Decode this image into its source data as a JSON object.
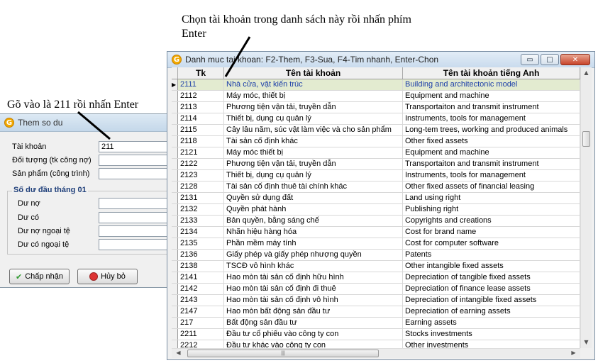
{
  "annotations": {
    "top": "Chọn tài khoản trong danh sách này rồi nhấn phím Enter",
    "left": "Gõ vào là 211 rồi nhấn Enter"
  },
  "dialog": {
    "title": "Them so du",
    "fields": [
      {
        "label": "Tài khoản",
        "value": "211"
      },
      {
        "label": "Đối tượng (tk công nợ)",
        "value": ""
      },
      {
        "label": "Sản phẩm (công trình)",
        "value": ""
      }
    ],
    "group_title": "Số dư đầu tháng 01",
    "balances": [
      {
        "label": "Dư nợ",
        "value": ""
      },
      {
        "label": "Dư có",
        "value": ""
      },
      {
        "label": "Dư nợ ngoại tệ",
        "value": ""
      },
      {
        "label": "Dư có ngoại tệ",
        "value": ""
      }
    ],
    "ok_label": "Chấp nhận",
    "cancel_label": "Hủy bỏ"
  },
  "window": {
    "title": "Danh muc tai khoan: F2-Them, F3-Sua, F4-Tim nhanh, Enter-Chon",
    "columns": [
      "Tk",
      "Tên tài khoản",
      "Tên tài khoản tiếng Anh"
    ],
    "rows": [
      {
        "tk": "2111",
        "name": "Nhà cửa, vật kiến trúc",
        "en": "Building and architectonic model",
        "selected": true
      },
      {
        "tk": "2112",
        "name": "Máy móc, thiết bị",
        "en": "Equipment and machine"
      },
      {
        "tk": "2113",
        "name": "Phương tiện vận tải, truyền dẫn",
        "en": "Transportaiton and transmit instrument"
      },
      {
        "tk": "2114",
        "name": "Thiết bị, dụng cụ quản lý",
        "en": "Instruments, tools for management"
      },
      {
        "tk": "2115",
        "name": "Cây lâu năm, súc vật làm việc và cho sản phẩm",
        "en": "Long-tem trees, working and produced animals"
      },
      {
        "tk": "2118",
        "name": "Tài sản cố định khác",
        "en": "Other fixed assets"
      },
      {
        "tk": "2121",
        "name": "Máy móc thiết bị",
        "en": "Equipment and machine"
      },
      {
        "tk": "2122",
        "name": "Phương tiện vận tải, truyền dẫn",
        "en": "Transportaiton and transmit instrument"
      },
      {
        "tk": "2123",
        "name": "Thiết bị, dụng cụ quản lý",
        "en": "Instruments, tools for management"
      },
      {
        "tk": "2128",
        "name": "Tài sản cố định thuê tài chính khác",
        "en": "Other fixed assets of financial leasing"
      },
      {
        "tk": "2131",
        "name": "Quyền sử dụng đất",
        "en": "Land using right"
      },
      {
        "tk": "2132",
        "name": "Quyền phát hành",
        "en": "Publishing right"
      },
      {
        "tk": "2133",
        "name": "Bản quyền, bằng sáng chế",
        "en": "Copyrights and creations"
      },
      {
        "tk": "2134",
        "name": "Nhãn hiệu hàng hóa",
        "en": "Cost for brand name"
      },
      {
        "tk": "2135",
        "name": "Phần mềm máy tính",
        "en": "Cost for computer software"
      },
      {
        "tk": "2136",
        "name": "Giấy phép và giấy phép nhượng quyền",
        "en": "Patents"
      },
      {
        "tk": "2138",
        "name": "TSCĐ vô hình khác",
        "en": "Other intangible fixed assets"
      },
      {
        "tk": "2141",
        "name": "Hao mòn tài sản cố định hữu hình",
        "en": "Depreciation of tangible fixed assets"
      },
      {
        "tk": "2142",
        "name": "Hao mòn tài sản cố định đi thuê",
        "en": "Depreciation of finance lease assets"
      },
      {
        "tk": "2143",
        "name": "Hao mòn tài sản cố định vô hình",
        "en": "Depreciation of intangible fixed assets"
      },
      {
        "tk": "2147",
        "name": "Hao mòn bất động sản đầu tư",
        "en": "Depreciation of earning assets"
      },
      {
        "tk": "217",
        "name": "Bất động sản đầu tư",
        "en": "Earning assets"
      },
      {
        "tk": "2211",
        "name": "Đầu tư cổ phiếu vào công ty con",
        "en": "Stocks investments"
      },
      {
        "tk": "2212",
        "name": "Đầu tư khác vào công ty con",
        "en": "Other investments"
      }
    ]
  },
  "icons": {
    "app": "G",
    "minimize": "▭",
    "maximize": "□",
    "close": "✕"
  }
}
